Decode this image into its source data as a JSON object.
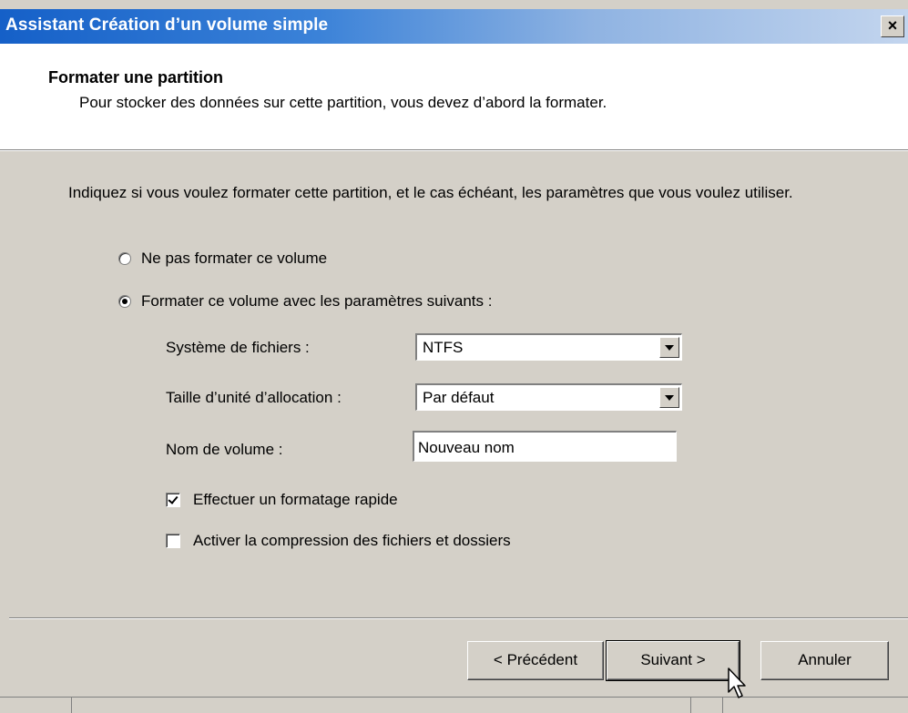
{
  "window": {
    "title": "Assistant Création d’un volume simple",
    "close_glyph": "×"
  },
  "header": {
    "title": "Formater une partition",
    "subtitle": "Pour stocker des données sur cette partition, vous devez d’abord la formater."
  },
  "body": {
    "instructions": "Indiquez si vous voulez formater cette partition, et le cas échéant, les paramètres que vous voulez utiliser.",
    "options": [
      {
        "label": "Ne pas formater ce volume",
        "selected": false
      },
      {
        "label": "Formater ce volume avec les paramètres suivants :",
        "selected": true
      }
    ],
    "filesystem": {
      "label": "Système de fichiers :",
      "value": "NTFS"
    },
    "allocation_unit": {
      "label": "Taille d’unité d’allocation :",
      "value": "Par défaut"
    },
    "volume_name": {
      "label": "Nom de volume :",
      "value": "Nouveau nom"
    },
    "quick_format": {
      "label": "Effectuer un formatage rapide",
      "checked": true
    },
    "compression": {
      "label": "Activer la compression des fichiers et dossiers",
      "checked": false
    }
  },
  "buttons": {
    "previous": "< Précédent",
    "next": "Suivant >",
    "cancel": "Annuler"
  },
  "colors": {
    "titlebar_start": "#1560c8",
    "titlebar_end": "#c3d5ee",
    "dialog_face": "#d4d0c8"
  }
}
